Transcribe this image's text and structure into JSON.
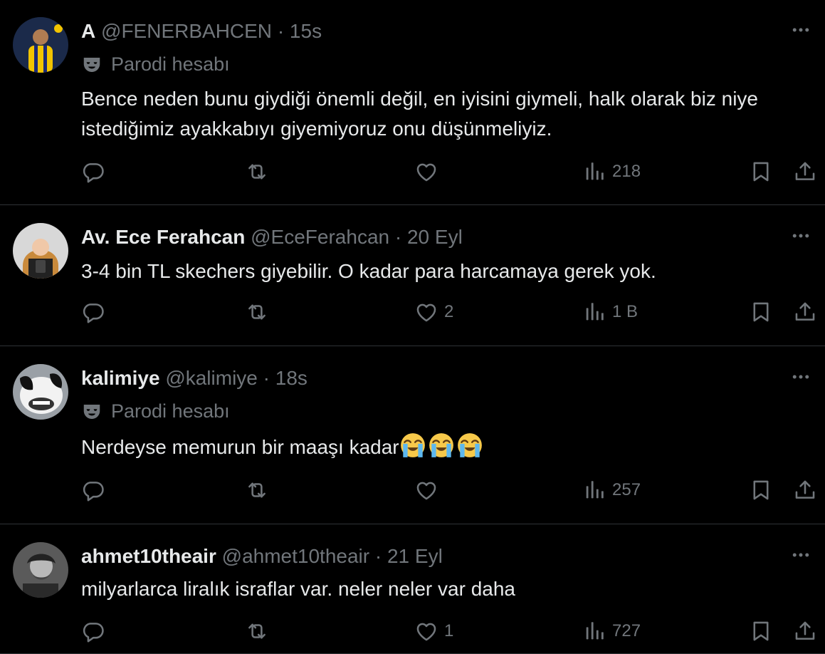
{
  "colors": {
    "background": "#000000",
    "text": "#e7e9ea",
    "muted": "#71767b",
    "divider": "#2f3336"
  },
  "tweets": [
    {
      "name": "A",
      "handle": "@FENERBAHCEN",
      "sep": "·",
      "time": "15s",
      "parody_label": "Parodi hesabı",
      "text": "Bence neden bunu giydiği önemli değil, en iyisini giymeli, halk olarak biz niye istediğimiz ayakkabıyı giyemiyoruz onu düşünmeliyiz.",
      "likes": "",
      "views": "218"
    },
    {
      "name": "Av. Ece Ferahcan",
      "handle": "@EceFerahcan",
      "sep": "·",
      "time": "20 Eyl",
      "text": "3-4 bin TL skechers giyebilir. O kadar para harcamaya gerek yok.",
      "likes": "2",
      "views": "1 B"
    },
    {
      "name": "kalimiye",
      "handle": "@kalimiye",
      "sep": "·",
      "time": "18s",
      "parody_label": "Parodi hesabı",
      "text": "Nerdeyse memurun bir maaşı kadar",
      "emoji": [
        "loudly-crying-face",
        "loudly-crying-face",
        "loudly-crying-face"
      ],
      "likes": "",
      "views": "257"
    },
    {
      "name": "ahmet10theair",
      "handle": "@ahmet10theair",
      "sep": "·",
      "time": "21 Eyl",
      "text": "milyarlarca liralık israflar var. neler neler var daha",
      "likes": "1",
      "views": "727"
    }
  ],
  "icons": [
    "reply-icon",
    "retweet-icon",
    "heart-icon",
    "views-icon",
    "bookmark-icon",
    "share-icon",
    "more-icon",
    "parody-mask-icon"
  ]
}
